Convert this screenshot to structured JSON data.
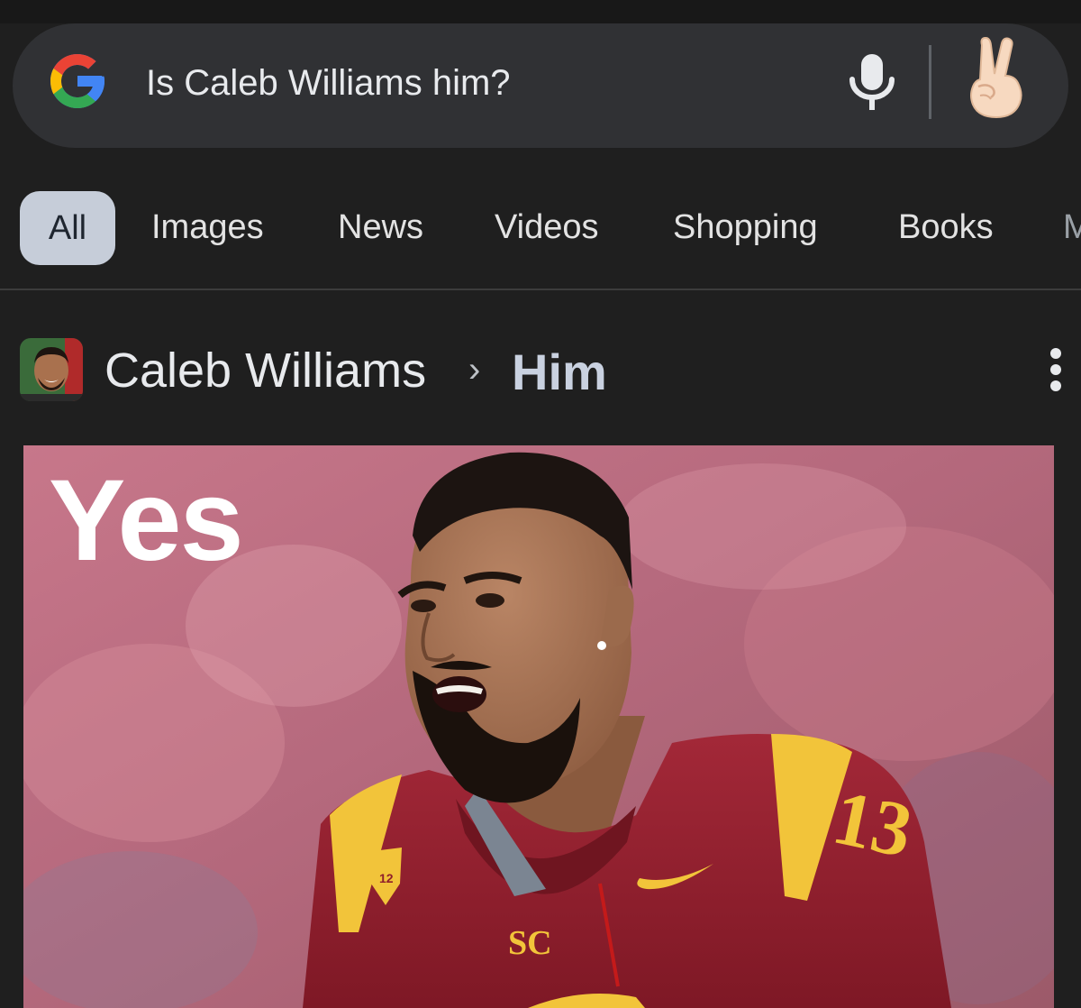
{
  "search": {
    "query": "Is Caleb Williams him?",
    "logo_icon": "google-g-icon",
    "voice_icon": "microphone-icon",
    "account_icon": "victory-hand-emoji-icon"
  },
  "tabs": [
    {
      "label": "All",
      "selected": true
    },
    {
      "label": "Images",
      "selected": false
    },
    {
      "label": "News",
      "selected": false
    },
    {
      "label": "Videos",
      "selected": false
    },
    {
      "label": "Shopping",
      "selected": false
    },
    {
      "label": "Books",
      "selected": false
    },
    {
      "label": "M",
      "selected": false
    }
  ],
  "result": {
    "site_name": "Caleb Williams",
    "separator": "›",
    "page_name": "Him",
    "menu_icon": "more-vert-icon",
    "image_caption": "Yes",
    "jersey_number": "13",
    "jersey_logo": "SC"
  },
  "colors": {
    "background": "#1f1f1f",
    "search_bar": "#303134",
    "selected_tab": "#c6cdd9",
    "jersey_cardinal": "#8f1f2b",
    "jersey_gold": "#f2c43a"
  }
}
